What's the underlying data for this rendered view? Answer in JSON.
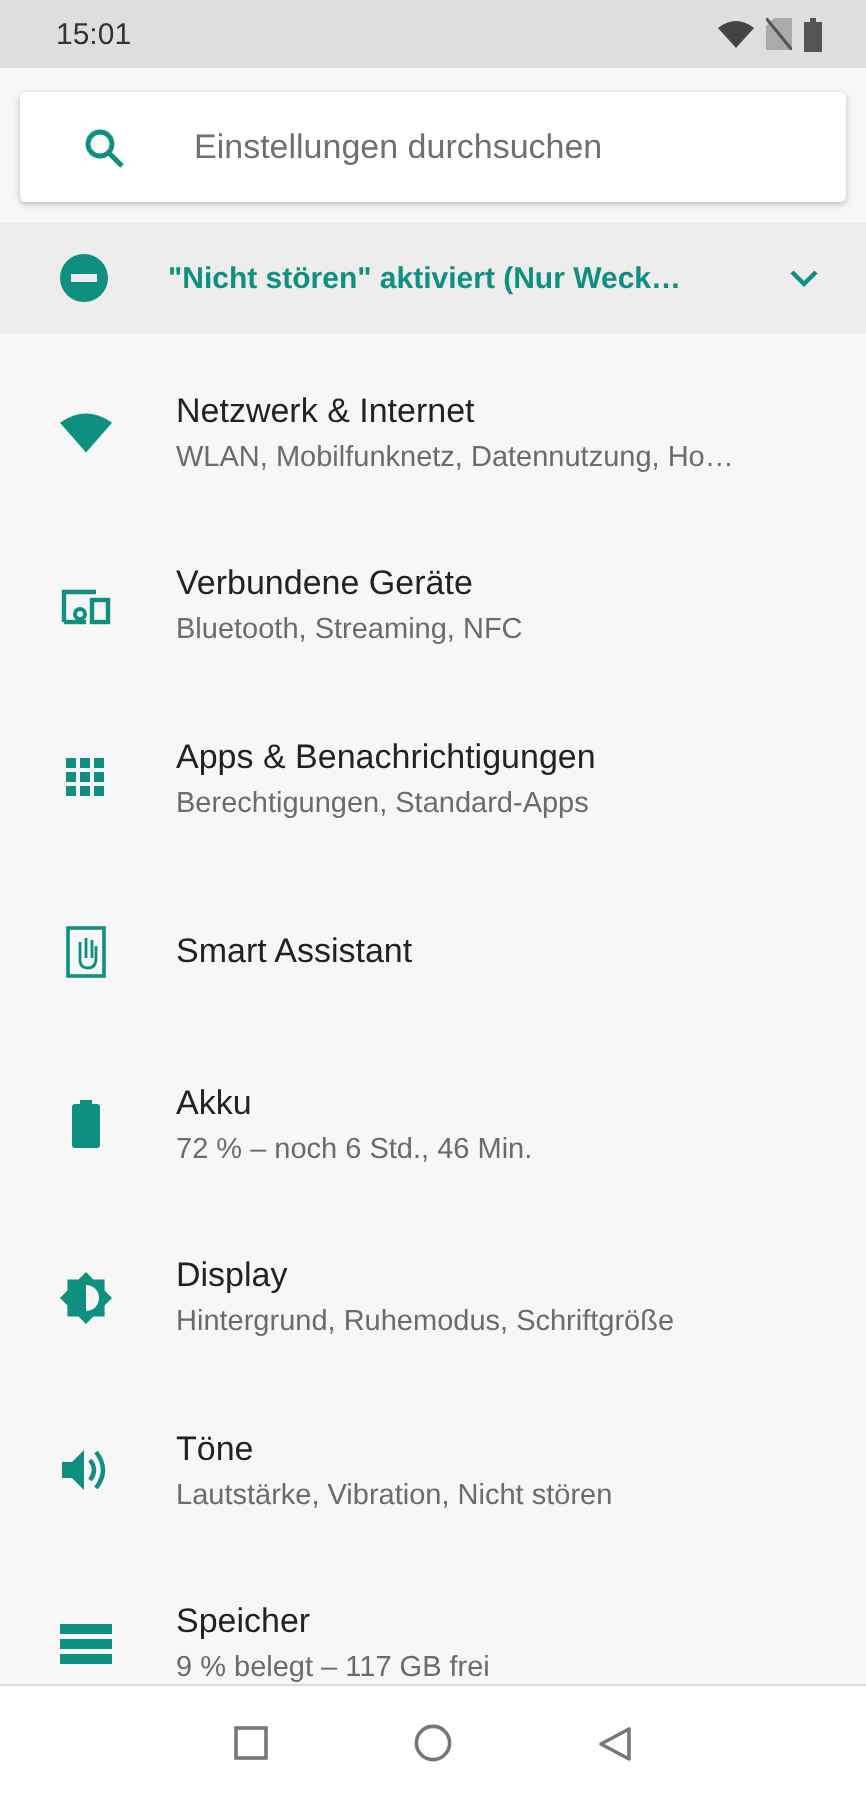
{
  "status_bar": {
    "time": "15:01"
  },
  "search": {
    "placeholder": "Einstellungen durchsuchen"
  },
  "dnd_banner": {
    "text": "\"Nicht stören\" aktiviert (Nur Weck…",
    "expanded": false
  },
  "items": [
    {
      "kind": "wifi",
      "title": "Netzwerk & Internet",
      "subtitle": "WLAN, Mobilfunknetz, Datennutzung, Ho…"
    },
    {
      "kind": "devices",
      "title": "Verbundene Geräte",
      "subtitle": "Bluetooth, Streaming, NFC"
    },
    {
      "kind": "apps",
      "title": "Apps & Benachrichtigungen",
      "subtitle": "Berechtigungen, Standard-Apps"
    },
    {
      "kind": "assistant",
      "title": "Smart Assistant"
    },
    {
      "kind": "battery",
      "title": "Akku",
      "subtitle": "72 % – noch 6 Std., 46 Min."
    },
    {
      "kind": "display",
      "title": "Display",
      "subtitle": "Hintergrund, Ruhemodus, Schriftgröße"
    },
    {
      "kind": "sound",
      "title": "Töne",
      "subtitle": "Lautstärke, Vibration, Nicht stören"
    },
    {
      "kind": "storage",
      "title": "Speicher",
      "subtitle": "9 % belegt – 117 GB frei"
    }
  ]
}
